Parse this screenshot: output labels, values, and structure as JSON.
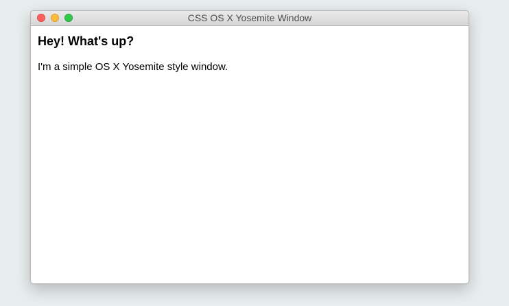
{
  "window": {
    "title": "CSS OS X Yosemite Window",
    "controls": {
      "close": {
        "icon": "close-traffic-light-icon",
        "color": "#fc605c"
      },
      "minimize": {
        "icon": "minimize-traffic-light-icon",
        "color": "#fdbc40"
      },
      "zoom": {
        "icon": "zoom-traffic-light-icon",
        "color": "#34c84a"
      }
    }
  },
  "content": {
    "heading": "Hey! What's up?",
    "body": "I'm a simple OS X Yosemite style window."
  },
  "colors": {
    "desktop_background": "#e8eded",
    "window_background": "#ffffff"
  }
}
